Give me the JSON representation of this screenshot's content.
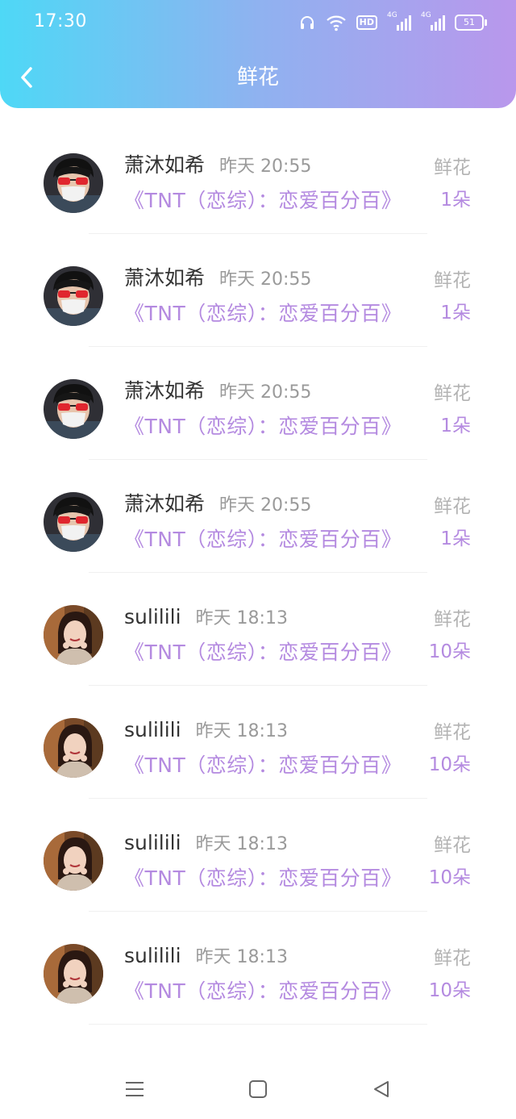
{
  "status_bar": {
    "time": "17:30",
    "hd_label": "HD",
    "signal1_label": "4G",
    "signal2_label": "4G",
    "battery": "51",
    "icons": [
      "headset-icon",
      "wifi-icon",
      "hd-icon",
      "signal-4g-icon",
      "signal-4g-icon",
      "battery-icon"
    ]
  },
  "header": {
    "title": "鲜花",
    "back_icon": "chevron-left-icon"
  },
  "colors": {
    "gradient_start": "#4ed8f6",
    "gradient_end": "#b997ec",
    "accent_purple": "#b48ae0",
    "name_text": "#333333",
    "muted_text": "#9a9a9a"
  },
  "rows": [
    {
      "user": "萧沐如希",
      "time": "昨天 20:55",
      "book": "《TNT（恋综）：恋爱百分百》",
      "gift_type": "鲜花",
      "gift_count": "1朵",
      "avatar": "avatar-man-sunglasses"
    },
    {
      "user": "萧沐如希",
      "time": "昨天 20:55",
      "book": "《TNT（恋综）：恋爱百分百》",
      "gift_type": "鲜花",
      "gift_count": "1朵",
      "avatar": "avatar-man-sunglasses"
    },
    {
      "user": "萧沐如希",
      "time": "昨天 20:55",
      "book": "《TNT（恋综）：恋爱百分百》",
      "gift_type": "鲜花",
      "gift_count": "1朵",
      "avatar": "avatar-man-sunglasses"
    },
    {
      "user": "萧沐如希",
      "time": "昨天 20:55",
      "book": "《TNT（恋综）：恋爱百分百》",
      "gift_type": "鲜花",
      "gift_count": "1朵",
      "avatar": "avatar-man-sunglasses"
    },
    {
      "user": "sulilili",
      "time": "昨天 18:13",
      "book": "《TNT（恋综）：恋爱百分百》",
      "gift_type": "鲜花",
      "gift_count": "10朵",
      "avatar": "avatar-woman-smiling"
    },
    {
      "user": "sulilili",
      "time": "昨天 18:13",
      "book": "《TNT（恋综）：恋爱百分百》",
      "gift_type": "鲜花",
      "gift_count": "10朵",
      "avatar": "avatar-woman-smiling"
    },
    {
      "user": "sulilili",
      "time": "昨天 18:13",
      "book": "《TNT（恋综）：恋爱百分百》",
      "gift_type": "鲜花",
      "gift_count": "10朵",
      "avatar": "avatar-woman-smiling"
    },
    {
      "user": "sulilili",
      "time": "昨天 18:13",
      "book": "《TNT（恋综）：恋爱百分百》",
      "gift_type": "鲜花",
      "gift_count": "10朵",
      "avatar": "avatar-woman-smiling"
    }
  ],
  "system_nav": {
    "menu_icon": "menu-icon",
    "home_icon": "home-square-icon",
    "back_icon": "back-triangle-icon"
  }
}
